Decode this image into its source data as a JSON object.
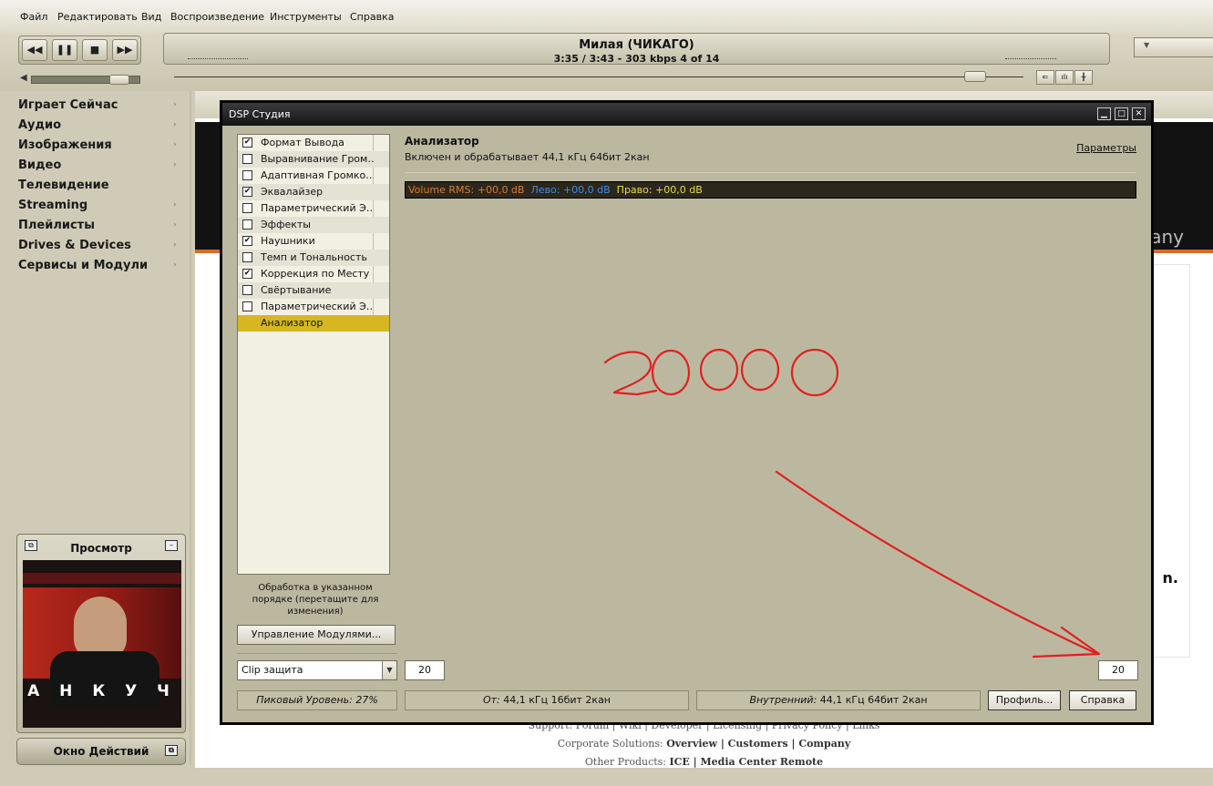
{
  "menu": [
    "Файл",
    "Редактировать",
    "Вид",
    "Воспроизведение",
    "Инструменты",
    "Справка"
  ],
  "player": {
    "track_title": "Милая (ЧИКАГО)",
    "track_info": "3:35 / 3:43 - 303 kbps  4 of 14",
    "position_fraction": 0.96,
    "volume_fraction": 0.75
  },
  "sidebar": {
    "items": [
      {
        "label": "Играет Сейчас",
        "arrow": true
      },
      {
        "label": "Аудио",
        "arrow": true
      },
      {
        "label": "Изображения",
        "arrow": true
      },
      {
        "label": "Видео",
        "arrow": true
      },
      {
        "label": "Телевидение",
        "arrow": false
      },
      {
        "label": "Streaming",
        "arrow": true
      },
      {
        "label": "Плейлисты",
        "arrow": true
      },
      {
        "label": "Drives & Devices",
        "arrow": true
      },
      {
        "label": "Сервисы и Модули",
        "arrow": true
      }
    ],
    "preview_title": "Просмотр",
    "album_text": "А Н  К У Ч",
    "action_window": "Окно Действий"
  },
  "background": {
    "company_fragment": "any",
    "dot_fragment": "n.",
    "footer_support": "Support: Forum | Wiki | Developer | Licensing | Privacy Policy | Links",
    "footer_corporate_prefix": "Corporate Solutions:",
    "footer_corporate_links": "Overview | Customers | Company",
    "footer_other_prefix": "Other Products:",
    "footer_other_links": "ICE | Media Center Remote"
  },
  "dsp": {
    "title": "DSP Студия",
    "modules": [
      {
        "label": "Формат Вывода",
        "checked": true
      },
      {
        "label": "Выравнивание Громкости",
        "checked": false
      },
      {
        "label": "Адаптивная Громкость",
        "checked": false
      },
      {
        "label": "Эквалайзер",
        "checked": true
      },
      {
        "label": "Параметрический Эквалайзер",
        "checked": false
      },
      {
        "label": "Эффекты",
        "checked": false
      },
      {
        "label": "Наушники",
        "checked": true
      },
      {
        "label": "Темп и Тональность",
        "checked": false
      },
      {
        "label": "Коррекция по Месту",
        "checked": true
      },
      {
        "label": "Свёртывание",
        "checked": false
      },
      {
        "label": "Параметрический Эквалайзер",
        "checked": false
      },
      {
        "label": "Анализатор",
        "checked": null,
        "selected": true
      }
    ],
    "order_note": "Обработка в указанном порядке (перетащите для изменения)",
    "manage_button": "Управление Модулями...",
    "analyzer_title": "Анализатор",
    "analyzer_status": "Включен и обрабатывает 44,1 кГц 64бит 2кан",
    "params_link": "Параметры",
    "rms_volume": "Volume RMS: +00,0 dB",
    "rms_left": "Лево: +00,0 dB",
    "rms_right": "Право: +00,0 dB",
    "annotation_text": "20000",
    "clip_option": "Clip защита",
    "clip_value_left": "20",
    "clip_value_right": "20",
    "peak_level": "Пиковый Уровень: 27%",
    "from_label": "От:",
    "from_value": "44,1 кГц 16бит 2кан",
    "internal_label": "Внутренний:",
    "internal_value": "44,1 кГц 64бит 2кан",
    "profile_button": "Профиль...",
    "help_button": "Справка"
  },
  "colors": {
    "annotation": "#e02020",
    "selection": "#d7b624",
    "rms_volume": "#e0792a",
    "rms_left": "#3b8de3",
    "rms_right": "#e8dc42"
  }
}
